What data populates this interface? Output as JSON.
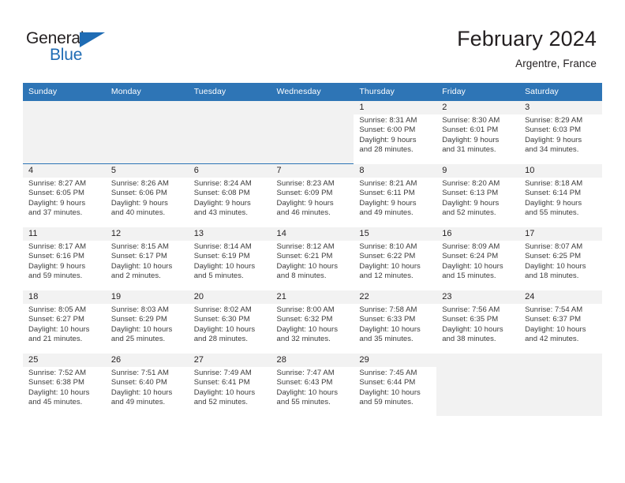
{
  "brand": {
    "name_part1": "General",
    "name_part2": "Blue",
    "accent_color": "#1f6cb4",
    "triangle_icon": "brand-triangle-icon"
  },
  "header": {
    "title": "February 2024",
    "location": "Argentre, France"
  },
  "calendar": {
    "header_bg": "#2e75b6",
    "weekdays": [
      "Sunday",
      "Monday",
      "Tuesday",
      "Wednesday",
      "Thursday",
      "Friday",
      "Saturday"
    ],
    "weeks": [
      {
        "shaded": true,
        "days": [
          {
            "empty": true
          },
          {
            "empty": true
          },
          {
            "empty": true
          },
          {
            "empty": true
          },
          {
            "date": "1",
            "sunrise": "Sunrise: 8:31 AM",
            "sunset": "Sunset: 6:00 PM",
            "daylight_line1": "Daylight: 9 hours",
            "daylight_line2": "and 28 minutes."
          },
          {
            "date": "2",
            "sunrise": "Sunrise: 8:30 AM",
            "sunset": "Sunset: 6:01 PM",
            "daylight_line1": "Daylight: 9 hours",
            "daylight_line2": "and 31 minutes."
          },
          {
            "date": "3",
            "sunrise": "Sunrise: 8:29 AM",
            "sunset": "Sunset: 6:03 PM",
            "daylight_line1": "Daylight: 9 hours",
            "daylight_line2": "and 34 minutes."
          }
        ]
      },
      {
        "shaded": true,
        "days": [
          {
            "date": "4",
            "sunrise": "Sunrise: 8:27 AM",
            "sunset": "Sunset: 6:05 PM",
            "daylight_line1": "Daylight: 9 hours",
            "daylight_line2": "and 37 minutes."
          },
          {
            "date": "5",
            "sunrise": "Sunrise: 8:26 AM",
            "sunset": "Sunset: 6:06 PM",
            "daylight_line1": "Daylight: 9 hours",
            "daylight_line2": "and 40 minutes."
          },
          {
            "date": "6",
            "sunrise": "Sunrise: 8:24 AM",
            "sunset": "Sunset: 6:08 PM",
            "daylight_line1": "Daylight: 9 hours",
            "daylight_line2": "and 43 minutes."
          },
          {
            "date": "7",
            "sunrise": "Sunrise: 8:23 AM",
            "sunset": "Sunset: 6:09 PM",
            "daylight_line1": "Daylight: 9 hours",
            "daylight_line2": "and 46 minutes."
          },
          {
            "date": "8",
            "sunrise": "Sunrise: 8:21 AM",
            "sunset": "Sunset: 6:11 PM",
            "daylight_line1": "Daylight: 9 hours",
            "daylight_line2": "and 49 minutes."
          },
          {
            "date": "9",
            "sunrise": "Sunrise: 8:20 AM",
            "sunset": "Sunset: 6:13 PM",
            "daylight_line1": "Daylight: 9 hours",
            "daylight_line2": "and 52 minutes."
          },
          {
            "date": "10",
            "sunrise": "Sunrise: 8:18 AM",
            "sunset": "Sunset: 6:14 PM",
            "daylight_line1": "Daylight: 9 hours",
            "daylight_line2": "and 55 minutes."
          }
        ]
      },
      {
        "shaded": true,
        "days": [
          {
            "date": "11",
            "sunrise": "Sunrise: 8:17 AM",
            "sunset": "Sunset: 6:16 PM",
            "daylight_line1": "Daylight: 9 hours",
            "daylight_line2": "and 59 minutes."
          },
          {
            "date": "12",
            "sunrise": "Sunrise: 8:15 AM",
            "sunset": "Sunset: 6:17 PM",
            "daylight_line1": "Daylight: 10 hours",
            "daylight_line2": "and 2 minutes."
          },
          {
            "date": "13",
            "sunrise": "Sunrise: 8:14 AM",
            "sunset": "Sunset: 6:19 PM",
            "daylight_line1": "Daylight: 10 hours",
            "daylight_line2": "and 5 minutes."
          },
          {
            "date": "14",
            "sunrise": "Sunrise: 8:12 AM",
            "sunset": "Sunset: 6:21 PM",
            "daylight_line1": "Daylight: 10 hours",
            "daylight_line2": "and 8 minutes."
          },
          {
            "date": "15",
            "sunrise": "Sunrise: 8:10 AM",
            "sunset": "Sunset: 6:22 PM",
            "daylight_line1": "Daylight: 10 hours",
            "daylight_line2": "and 12 minutes."
          },
          {
            "date": "16",
            "sunrise": "Sunrise: 8:09 AM",
            "sunset": "Sunset: 6:24 PM",
            "daylight_line1": "Daylight: 10 hours",
            "daylight_line2": "and 15 minutes."
          },
          {
            "date": "17",
            "sunrise": "Sunrise: 8:07 AM",
            "sunset": "Sunset: 6:25 PM",
            "daylight_line1": "Daylight: 10 hours",
            "daylight_line2": "and 18 minutes."
          }
        ]
      },
      {
        "shaded": true,
        "days": [
          {
            "date": "18",
            "sunrise": "Sunrise: 8:05 AM",
            "sunset": "Sunset: 6:27 PM",
            "daylight_line1": "Daylight: 10 hours",
            "daylight_line2": "and 21 minutes."
          },
          {
            "date": "19",
            "sunrise": "Sunrise: 8:03 AM",
            "sunset": "Sunset: 6:29 PM",
            "daylight_line1": "Daylight: 10 hours",
            "daylight_line2": "and 25 minutes."
          },
          {
            "date": "20",
            "sunrise": "Sunrise: 8:02 AM",
            "sunset": "Sunset: 6:30 PM",
            "daylight_line1": "Daylight: 10 hours",
            "daylight_line2": "and 28 minutes."
          },
          {
            "date": "21",
            "sunrise": "Sunrise: 8:00 AM",
            "sunset": "Sunset: 6:32 PM",
            "daylight_line1": "Daylight: 10 hours",
            "daylight_line2": "and 32 minutes."
          },
          {
            "date": "22",
            "sunrise": "Sunrise: 7:58 AM",
            "sunset": "Sunset: 6:33 PM",
            "daylight_line1": "Daylight: 10 hours",
            "daylight_line2": "and 35 minutes."
          },
          {
            "date": "23",
            "sunrise": "Sunrise: 7:56 AM",
            "sunset": "Sunset: 6:35 PM",
            "daylight_line1": "Daylight: 10 hours",
            "daylight_line2": "and 38 minutes."
          },
          {
            "date": "24",
            "sunrise": "Sunrise: 7:54 AM",
            "sunset": "Sunset: 6:37 PM",
            "daylight_line1": "Daylight: 10 hours",
            "daylight_line2": "and 42 minutes."
          }
        ]
      },
      {
        "shaded": true,
        "days": [
          {
            "date": "25",
            "sunrise": "Sunrise: 7:52 AM",
            "sunset": "Sunset: 6:38 PM",
            "daylight_line1": "Daylight: 10 hours",
            "daylight_line2": "and 45 minutes."
          },
          {
            "date": "26",
            "sunrise": "Sunrise: 7:51 AM",
            "sunset": "Sunset: 6:40 PM",
            "daylight_line1": "Daylight: 10 hours",
            "daylight_line2": "and 49 minutes."
          },
          {
            "date": "27",
            "sunrise": "Sunrise: 7:49 AM",
            "sunset": "Sunset: 6:41 PM",
            "daylight_line1": "Daylight: 10 hours",
            "daylight_line2": "and 52 minutes."
          },
          {
            "date": "28",
            "sunrise": "Sunrise: 7:47 AM",
            "sunset": "Sunset: 6:43 PM",
            "daylight_line1": "Daylight: 10 hours",
            "daylight_line2": "and 55 minutes."
          },
          {
            "date": "29",
            "sunrise": "Sunrise: 7:45 AM",
            "sunset": "Sunset: 6:44 PM",
            "daylight_line1": "Daylight: 10 hours",
            "daylight_line2": "and 59 minutes."
          },
          {
            "empty": true
          },
          {
            "empty": true
          }
        ]
      }
    ]
  }
}
